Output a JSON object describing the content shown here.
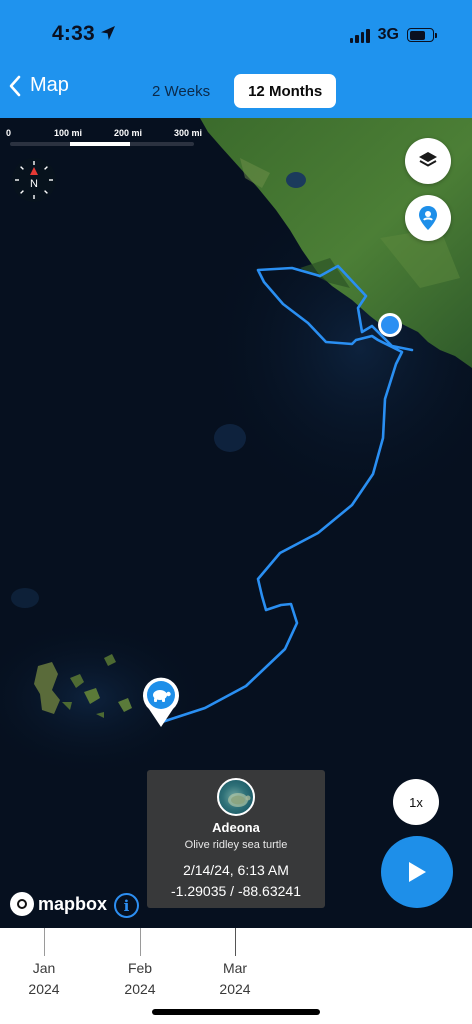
{
  "status_bar": {
    "time": "4:33",
    "network": "3G",
    "location_icon": "location-arrow-icon",
    "signal_icon": "cellular-signal-icon",
    "battery_icon": "battery-icon"
  },
  "nav": {
    "back_label": "Map",
    "back_icon": "chevron-left-icon",
    "tabs": [
      {
        "label": "2 Weeks",
        "active": false
      },
      {
        "label": "12 Months",
        "active": true
      }
    ]
  },
  "map": {
    "scale_labels": [
      "0",
      "100 mi",
      "200 mi",
      "300 mi"
    ],
    "compass_label": "N",
    "layers_icon": "layers-icon",
    "pin_icon": "location-pin-icon",
    "playback_speed": "1x",
    "play_icon": "play-icon",
    "attribution": "mapbox",
    "info_icon_label": "i",
    "track_color": "#2a8ff2",
    "start_marker_icon": "turtle-icon",
    "end_marker": "current-position-dot"
  },
  "info_card": {
    "name": "Adeona",
    "species": "Olive ridley sea turtle",
    "datetime": "2/14/24, 6:13 AM",
    "coords": "-1.29035 / -88.63241"
  },
  "timeline": {
    "labels": [
      {
        "month": "Jan",
        "year": "2024"
      },
      {
        "month": "Feb",
        "year": "2024"
      },
      {
        "month": "Mar",
        "year": "2024"
      }
    ]
  }
}
